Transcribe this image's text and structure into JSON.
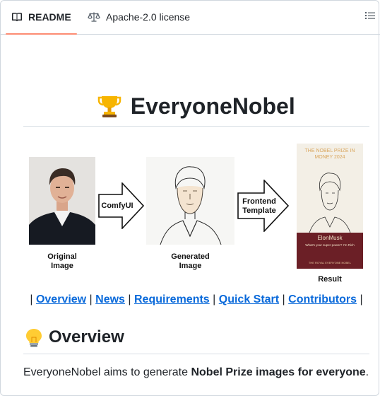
{
  "tabs": {
    "readme_label": "README",
    "license_label": "Apache-2.0 license"
  },
  "heading": {
    "title": "EveryoneNobel",
    "emoji_icon": "trophy-icon"
  },
  "pipeline": {
    "original_caption": "Original\nImage",
    "arrow1_label": "ComfyUI",
    "generated_caption": "Generated\nImage",
    "arrow2_label": "Frontend\nTemplate",
    "result_caption": "Result",
    "card": {
      "title_line1": "THE NOBEL PRIZE IN",
      "title_line2": "MONEY 2024",
      "name": "ElonMusk",
      "subtitle": "What's your super power? I'm Rich",
      "footer": "THE ROYAL EVERYONE NOBEL"
    }
  },
  "links": [
    {
      "label": "Overview"
    },
    {
      "label": "News"
    },
    {
      "label": "Requirements"
    },
    {
      "label": "Quick Start"
    },
    {
      "label": "Contributors"
    }
  ],
  "overview": {
    "heading": "Overview",
    "emoji_icon": "lightbulb-icon",
    "text_prefix": "EveryoneNobel aims to generate ",
    "text_bold": "Nobel Prize images for everyone",
    "text_suffix": "."
  },
  "colors": {
    "tab_underline": "#fd8c73",
    "link": "#0969da",
    "card_band": "#6b1f26",
    "card_title": "#d9a55c"
  }
}
